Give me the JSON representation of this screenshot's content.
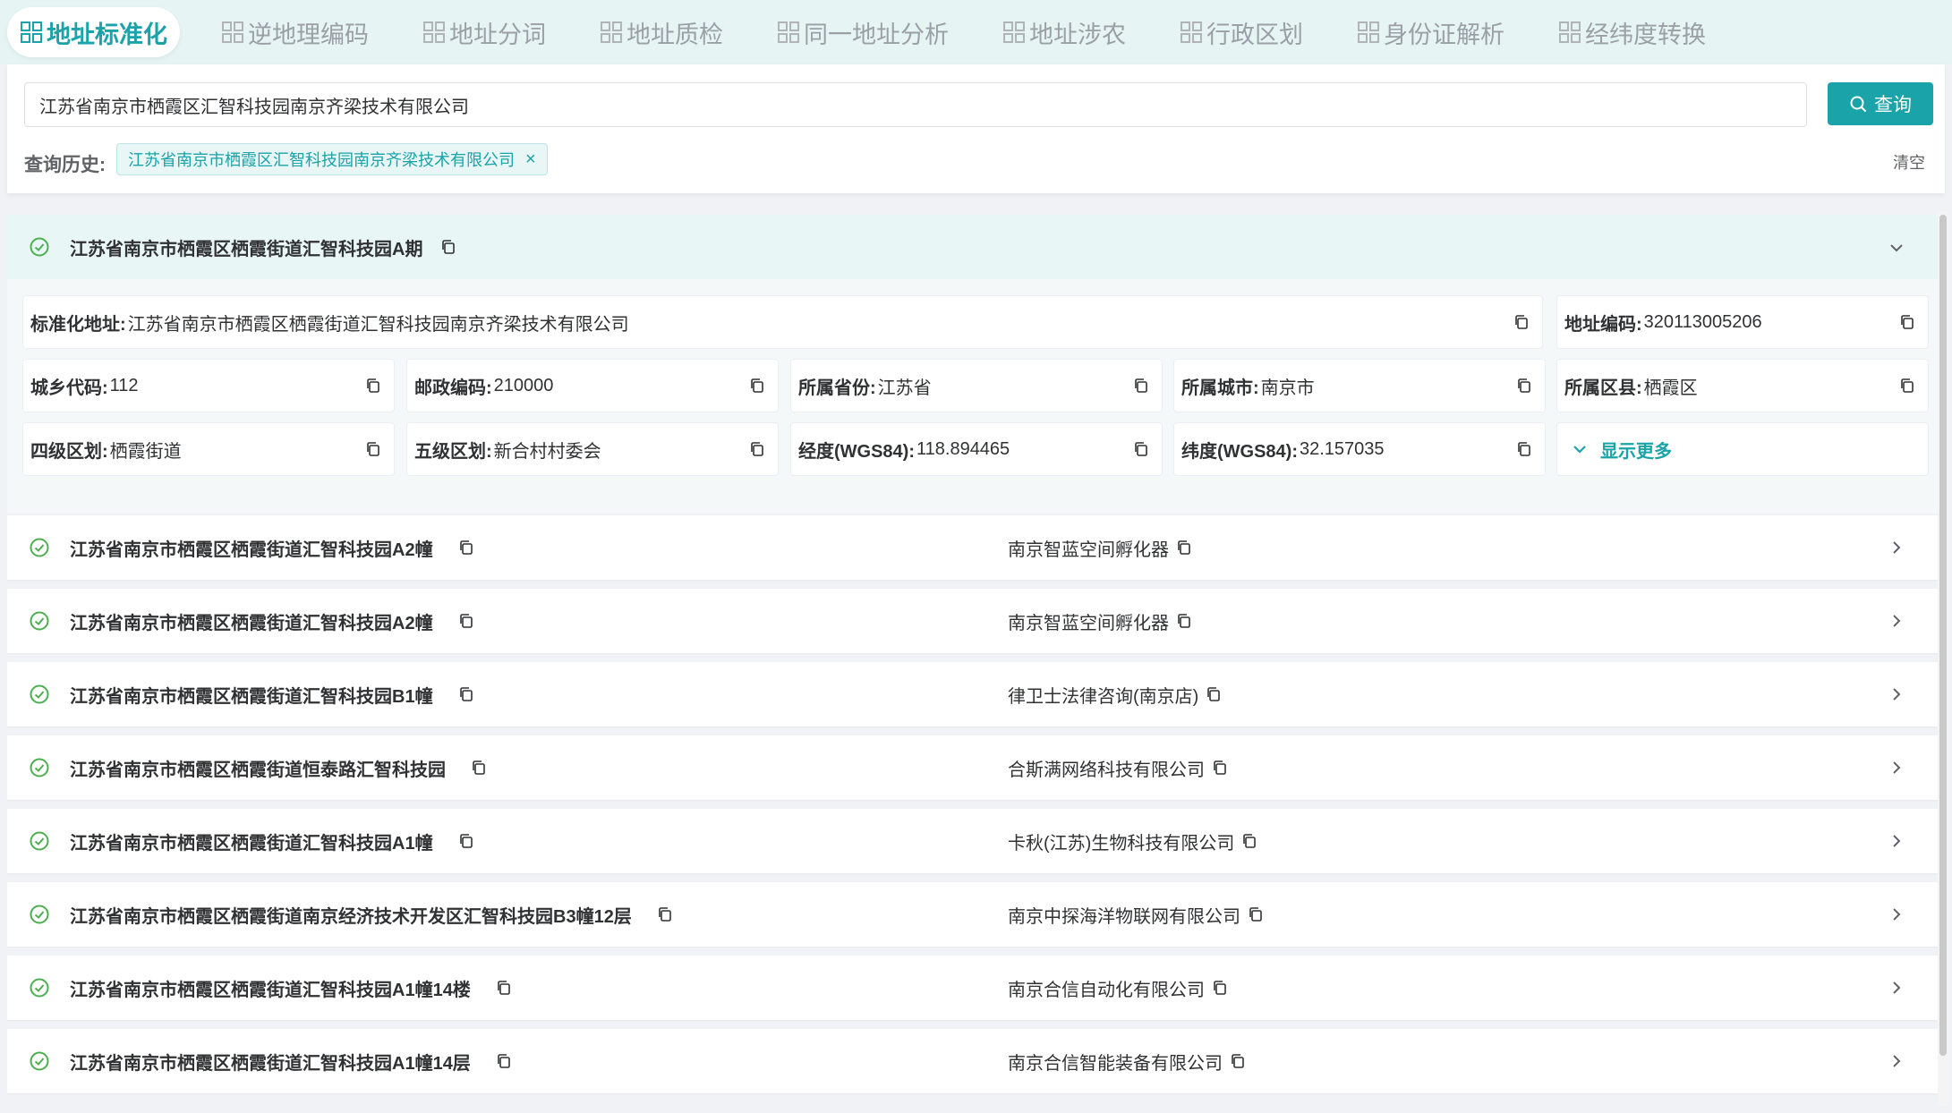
{
  "tabs": [
    {
      "label": "地址标准化",
      "active": true
    },
    {
      "label": "逆地理编码",
      "active": false
    },
    {
      "label": "地址分词",
      "active": false
    },
    {
      "label": "地址质检",
      "active": false
    },
    {
      "label": "同一地址分析",
      "active": false
    },
    {
      "label": "地址涉农",
      "active": false
    },
    {
      "label": "行政区划",
      "active": false
    },
    {
      "label": "身份证解析",
      "active": false
    },
    {
      "label": "经纬度转换",
      "active": false
    }
  ],
  "search": {
    "value": "江苏省南京市栖霞区汇智科技园南京齐梁技术有限公司",
    "button_label": "查询"
  },
  "history": {
    "label": "查询历史:",
    "chip": "江苏省南京市栖霞区汇智科技园南京齐梁技术有限公司",
    "clear_label": "清空"
  },
  "expanded": {
    "title": "江苏省南京市栖霞区栖霞街道汇智科技园A期",
    "standard_address": {
      "label": "标准化地址:",
      "value": "江苏省南京市栖霞区栖霞街道汇智科技园南京齐梁技术有限公司"
    },
    "address_code": {
      "label": "地址编码:",
      "value": "320113005206"
    },
    "urban_rural_code": {
      "label": "城乡代码:",
      "value": "112"
    },
    "postal_code": {
      "label": "邮政编码:",
      "value": "210000"
    },
    "province": {
      "label": "所属省份:",
      "value": "江苏省"
    },
    "city": {
      "label": "所属城市:",
      "value": "南京市"
    },
    "district": {
      "label": "所属区县:",
      "value": "栖霞区"
    },
    "level4": {
      "label": "四级区划:",
      "value": "栖霞街道"
    },
    "level5": {
      "label": "五级区划:",
      "value": "新合村村委会"
    },
    "longitude": {
      "label": "经度(WGS84):",
      "value": "118.894465"
    },
    "latitude": {
      "label": "纬度(WGS84):",
      "value": "32.157035"
    },
    "show_more_label": "显示更多"
  },
  "results": [
    {
      "address": "江苏省南京市栖霞区栖霞街道汇智科技园A2幢",
      "org": "南京智蓝空间孵化器"
    },
    {
      "address": "江苏省南京市栖霞区栖霞街道汇智科技园A2幢",
      "org": "南京智蓝空间孵化器"
    },
    {
      "address": "江苏省南京市栖霞区栖霞街道汇智科技园B1幢",
      "org": "律卫士法律咨询(南京店)"
    },
    {
      "address": "江苏省南京市栖霞区栖霞街道恒泰路汇智科技园",
      "org": "合斯满网络科技有限公司"
    },
    {
      "address": "江苏省南京市栖霞区栖霞街道汇智科技园A1幢",
      "org": "卡秋(江苏)生物科技有限公司"
    },
    {
      "address": "江苏省南京市栖霞区栖霞街道南京经济技术开发区汇智科技园B3幢12层",
      "org": "南京中探海洋物联网有限公司"
    },
    {
      "address": "江苏省南京市栖霞区栖霞街道汇智科技园A1幢14楼",
      "org": "南京合信自动化有限公司"
    },
    {
      "address": "江苏省南京市栖霞区栖霞街道汇智科技园A1幢14层",
      "org": "南京合信智能装备有限公司"
    }
  ],
  "colors": {
    "accent": "#1aa3a8",
    "check": "#4caf50",
    "tab_bg": "#e6f4f4",
    "header_bg": "#e8f6f6"
  }
}
